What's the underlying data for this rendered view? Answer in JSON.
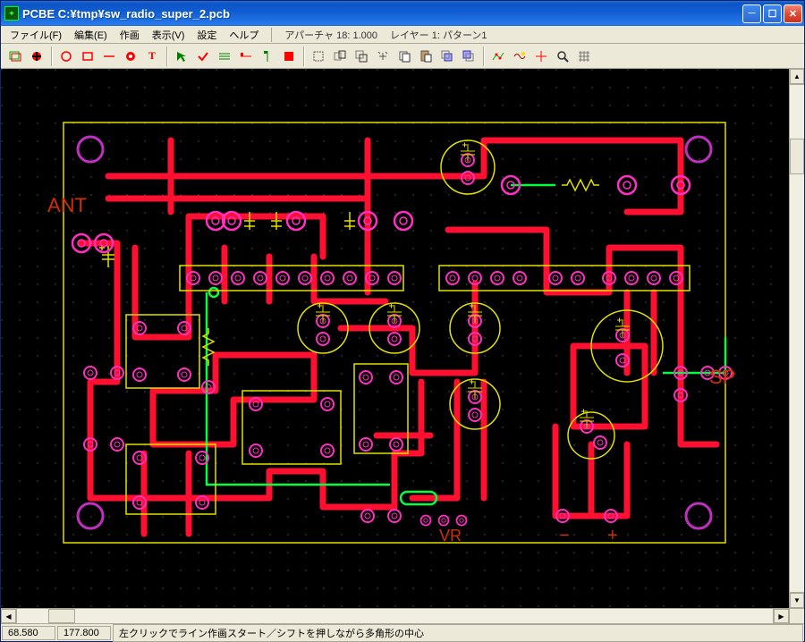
{
  "title": "PCBE   C:¥tmp¥sw_radio_super_2.pcb",
  "menu": {
    "file": "ファイル(F)",
    "edit": "編集(E)",
    "draw": "作画",
    "view": "表示(V)",
    "settings": "設定",
    "help": "ヘルプ"
  },
  "info": {
    "aperture": "アパーチャ 18: 1.000",
    "layer": "レイヤー 1: パターン1"
  },
  "status": {
    "x": "68.580",
    "y": "177.800",
    "msg": "左クリックでライン作画スタート／シフトを押しながら多角形の中心"
  },
  "labels": {
    "ant": "ANT",
    "sp": "SP",
    "vr": "VR",
    "minus": "−",
    "plus": "+"
  },
  "colors": {
    "trace": "#ff1030",
    "pad": "#ff30c0",
    "silk": "#e0e000",
    "aux": "#00ff40",
    "bg": "#000000"
  }
}
